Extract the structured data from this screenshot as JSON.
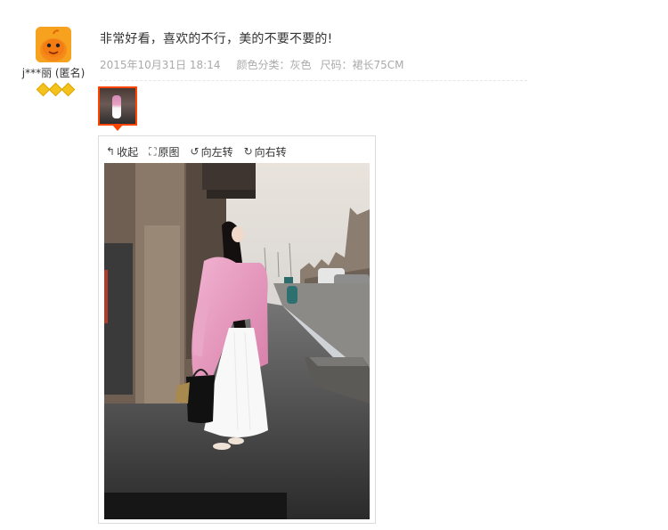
{
  "reviewer": {
    "name": "j***丽 (匿名)",
    "level_badges": 3,
    "avatar_color": "#f6a21e"
  },
  "review": {
    "text": "非常好看，喜欢的不行，美的不要不要的!",
    "date": "2015年10月31日 18:14",
    "color_attr": "颜色分类：灰色",
    "size_attr": "尺码：裙长75CM"
  },
  "viewer": {
    "toolbar": {
      "collapse_label": "收起",
      "original_label": "原图",
      "rotate_left_label": "向左转",
      "rotate_right_label": "向右转"
    },
    "icons": {
      "collapse": "collapse-icon",
      "original": "fullsize-icon",
      "rotate_left": "rotate-left-icon",
      "rotate_right": "rotate-right-icon"
    }
  },
  "colors": {
    "accent": "#ff4400",
    "meta_text": "#aaaaaa",
    "coat_pink": "#e7a0c2"
  }
}
